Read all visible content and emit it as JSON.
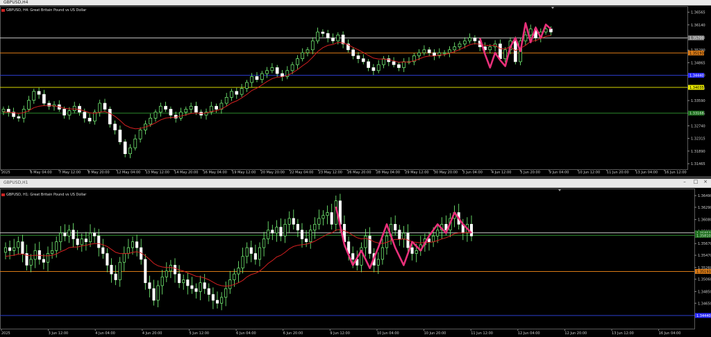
{
  "charts": [
    {
      "window_title": "GBPUSD,H4",
      "label": "GBPUSD, H4:  Great Britain Pound vs US Dollar",
      "price_axis": [
        "1.36565",
        "1.36140",
        "1.35715",
        "1.35290",
        "1.34865",
        "1.34440",
        "1.34015",
        "1.33590",
        "1.33165",
        "1.32740",
        "1.32315",
        "1.31890",
        "1.31465"
      ],
      "time_axis": [
        "2025",
        "6 May 04:00",
        "7 May 12:00",
        "8 May 20:00",
        "12 May 04:00",
        "13 May 12:00",
        "14 May 20:00",
        "16 May 04:00",
        "19 May 12:00",
        "20 May 20:00",
        "22 May 04:00",
        "23 May 12:00",
        "26 May 20:00",
        "28 May 04:00",
        "29 May 12:00",
        "30 May 20:00",
        "3 Jun 04:00",
        "4 Jun 12:00",
        "5 Jun 20:00",
        "9 Jun 04:00",
        "10 Jun 12:00",
        "11 Jun 20:00",
        "13 Jun 04:00",
        "16 Jun 12:00"
      ],
      "levels": [
        {
          "price": "1.35700",
          "color": "#c9c9c9",
          "tag_color": "#7a7a7a",
          "tag_text": "#ffffff"
        },
        {
          "price": "1.35193",
          "color": "#d97a16",
          "tag_color": "#d97a16",
          "tag_text": "#000000"
        },
        {
          "price": "1.34440",
          "color": "#2d3fd0",
          "tag_color": "#2a2aff",
          "tag_text": "#ffffff"
        },
        {
          "price": "1.34035",
          "color": "#d8d800",
          "tag_color": "#e8e800",
          "tag_text": "#000000"
        },
        {
          "price": "1.33168",
          "color": "#2d8a2d",
          "tag_color": "#1e6e1e",
          "tag_text": "#cfe8cf"
        }
      ]
    },
    {
      "window_title": "GBPUSD,H1",
      "label": "GBPUSD, H1:  Great Britain Pound vs US Dollar",
      "price_axis": [
        "1.36490",
        "1.36290",
        "1.36080",
        "1.35880",
        "1.35670",
        "1.35470",
        "1.35260",
        "1.35060",
        "1.34850",
        "1.34650",
        "1.34440"
      ],
      "time_axis": [
        "2025",
        "3 Jun 12:00",
        "4 Jun 04:00",
        "4 Jun 20:00",
        "5 Jun 12:00",
        "6 Jun 04:00",
        "6 Jun 20:00",
        "9 Jun 12:00",
        "10 Jun 04:00",
        "10 Jun 20:00",
        "11 Jun 12:00",
        "12 Jun 04:00",
        "12 Jun 20:00",
        "13 Jun 12:00",
        "16 Jun 04:00"
      ],
      "levels": [
        {
          "price": "1.35853",
          "color": "#c9c9c9",
          "tag_color": "#1e6e1e",
          "tag_text": "#cfe8cf"
        },
        {
          "price": "1.35810",
          "color": "#2d8a2d",
          "tag_color": "#1e6e1e",
          "tag_text": "#cfe8cf"
        },
        {
          "price": "1.35193",
          "color": "#d97a16",
          "tag_color": "#d97a16",
          "tag_text": "#000000"
        },
        {
          "price": "1.34440",
          "color": "#2d3fd0",
          "tag_color": "#2a2aff",
          "tag_text": "#ffffff"
        }
      ]
    }
  ],
  "chart_data": [
    {
      "type": "candlestick",
      "title": "GBPUSD, H4: Great Britain Pound vs US Dollar",
      "ylim": [
        1.3135,
        1.3665
      ],
      "series": [
        {
          "name": "close",
          "values": [
            1.333,
            1.332,
            1.3305,
            1.33,
            1.333,
            1.336,
            1.339,
            1.338,
            1.335,
            1.334,
            1.3345,
            1.333,
            1.331,
            1.3325,
            1.334,
            1.332,
            1.33,
            1.329,
            1.332,
            1.335,
            1.333,
            1.328,
            1.326,
            1.322,
            1.318,
            1.32,
            1.323,
            1.326,
            1.328,
            1.33,
            1.332,
            1.334,
            1.333,
            1.331,
            1.33,
            1.332,
            1.333,
            1.334,
            1.332,
            1.331,
            1.332,
            1.334,
            1.333,
            1.335,
            1.337,
            1.339,
            1.338,
            1.34,
            1.342,
            1.344,
            1.343,
            1.345,
            1.346,
            1.347,
            1.345,
            1.344,
            1.346,
            1.348,
            1.35,
            1.352,
            1.353,
            1.356,
            1.359,
            1.3585,
            1.357,
            1.356,
            1.358,
            1.355,
            1.353,
            1.351,
            1.35,
            1.349,
            1.347,
            1.346,
            1.348,
            1.35,
            1.349,
            1.348,
            1.347,
            1.349,
            1.349,
            1.351,
            1.352,
            1.353,
            1.352,
            1.351,
            1.352,
            1.352,
            1.353,
            1.354,
            1.355,
            1.356,
            1.357,
            1.356,
            1.354,
            1.353,
            1.354,
            1.355,
            1.35,
            1.353,
            1.356,
            1.349,
            1.356,
            1.358,
            1.36,
            1.357,
            1.359,
            1.36,
            1.359
          ]
        },
        {
          "name": "moving-average",
          "values": [
            1.332,
            1.332,
            1.3318,
            1.3316,
            1.3318,
            1.3325,
            1.3335,
            1.334,
            1.3342,
            1.3342,
            1.3341,
            1.3338,
            1.3333,
            1.3331,
            1.3331,
            1.3329,
            1.3324,
            1.3318,
            1.3316,
            1.332,
            1.3322,
            1.3316,
            1.3306,
            1.3292,
            1.3276,
            1.3268,
            1.3264,
            1.3265,
            1.327,
            1.3276,
            1.3284,
            1.3294,
            1.33,
            1.3302,
            1.3303,
            1.3307,
            1.3311,
            1.3316,
            1.3317,
            1.3316,
            1.3317,
            1.3322,
            1.3325,
            1.3331,
            1.334,
            1.3351,
            1.3358,
            1.3368,
            1.338,
            1.3393,
            1.3401,
            1.3412,
            1.3423,
            1.3433,
            1.3438,
            1.3439,
            1.3444,
            1.3452,
            1.3463,
            1.3476,
            1.3488,
            1.3505,
            1.3524,
            1.3537,
            1.3545,
            1.3548,
            1.3555,
            1.3553,
            1.3547,
            1.3538,
            1.353,
            1.3521,
            1.3511,
            1.3502,
            1.3499,
            1.3499,
            1.3497,
            1.3493,
            1.3488,
            1.3489,
            1.3489,
            1.3493,
            1.3499,
            1.3506,
            1.3509,
            1.3509,
            1.3512,
            1.3514,
            1.3518,
            1.3524,
            1.3531,
            1.3539,
            1.3547,
            1.3551,
            1.3549,
            1.3545,
            1.3544,
            1.3545,
            1.3534,
            1.3533,
            1.354,
            1.3527,
            1.3535,
            1.3545,
            1.3558,
            1.3561,
            1.3568,
            1.3575,
            1.3578
          ]
        },
        {
          "name": "zigzag",
          "x": [
            94,
            95,
            96,
            97,
            98,
            99,
            100,
            101,
            102,
            103,
            104,
            105,
            106,
            107,
            108
          ],
          "values": [
            1.357,
            1.3515,
            1.347,
            1.352,
            1.3495,
            1.3475,
            1.354,
            1.357,
            1.3525,
            1.362,
            1.3555,
            1.3605,
            1.357,
            1.3615,
            1.36
          ]
        }
      ]
    },
    {
      "type": "candlestick",
      "title": "GBPUSD, H1: Great Britain Pound vs US Dollar",
      "ylim": [
        1.3425,
        1.3655
      ],
      "series": [
        {
          "name": "close",
          "values": [
            1.356,
            1.3555,
            1.356,
            1.357,
            1.355,
            1.353,
            1.354,
            1.3555,
            1.354,
            1.3535,
            1.355,
            1.3555,
            1.357,
            1.3585,
            1.358,
            1.359,
            1.3575,
            1.3565,
            1.3575,
            1.357,
            1.3585,
            1.358,
            1.356,
            1.355,
            1.353,
            1.3515,
            1.3505,
            1.3535,
            1.355,
            1.356,
            1.357,
            1.356,
            1.354,
            1.35,
            1.349,
            1.347,
            1.3495,
            1.351,
            1.352,
            1.353,
            1.3515,
            1.35,
            1.3505,
            1.3495,
            1.349,
            1.3485,
            1.35,
            1.349,
            1.348,
            1.347,
            1.3465,
            1.3475,
            1.349,
            1.3505,
            1.3515,
            1.3525,
            1.3545,
            1.356,
            1.355,
            1.354,
            1.356,
            1.3575,
            1.359,
            1.3585,
            1.3595,
            1.358,
            1.36,
            1.361,
            1.36,
            1.359,
            1.3575,
            1.357,
            1.359,
            1.36,
            1.361,
            1.3615,
            1.362,
            1.36,
            1.364,
            1.36,
            1.357,
            1.355,
            1.354,
            1.353,
            1.356,
            1.358,
            1.355,
            1.353,
            1.354,
            1.356,
            1.358,
            1.36,
            1.359,
            1.3575,
            1.3585,
            1.356,
            1.355,
            1.3555,
            1.3565,
            1.3575,
            1.357,
            1.358,
            1.359,
            1.36,
            1.359,
            1.361,
            1.362,
            1.36,
            1.3585,
            1.36,
            1.358
          ]
        },
        {
          "name": "moving-average",
          "values": [
            1.3545,
            1.3546,
            1.3547,
            1.3549,
            1.3549,
            1.3547,
            1.3546,
            1.3547,
            1.3547,
            1.3546,
            1.3546,
            1.3547,
            1.3549,
            1.3553,
            1.3556,
            1.356,
            1.3561,
            1.3561,
            1.3563,
            1.3564,
            1.3566,
            1.3567,
            1.3567,
            1.3565,
            1.3562,
            1.3557,
            1.3552,
            1.355,
            1.355,
            1.355,
            1.3552,
            1.3553,
            1.3551,
            1.3546,
            1.354,
            1.3533,
            1.3529,
            1.3527,
            1.3526,
            1.3526,
            1.3525,
            1.3522,
            1.352,
            1.3517,
            1.3514,
            1.3511,
            1.351,
            1.3508,
            1.3505,
            1.3501,
            1.3497,
            1.3495,
            1.3494,
            1.3495,
            1.3497,
            1.35,
            1.3504,
            1.351,
            1.3514,
            1.3516,
            1.352,
            1.3526,
            1.3533,
            1.3538,
            1.3544,
            1.3547,
            1.3552,
            1.3558,
            1.3562,
            1.3564,
            1.3565,
            1.3566,
            1.3568,
            1.3571,
            1.3575,
            1.3579,
            1.3583,
            1.3585,
            1.359,
            1.3591,
            1.3589,
            1.3586,
            1.3581,
            1.3577,
            1.3575,
            1.3576,
            1.3574,
            1.357,
            1.3568,
            1.3567,
            1.3569,
            1.3572,
            1.3574,
            1.3574,
            1.3575,
            1.3573,
            1.357,
            1.3569,
            1.3568,
            1.3569,
            1.3569,
            1.357,
            1.3572,
            1.3575,
            1.3577,
            1.358,
            1.3584,
            1.3585,
            1.3585,
            1.3586,
            1.3585
          ]
        },
        {
          "name": "zigzag",
          "x": [
            78,
            80,
            82,
            84,
            86,
            88,
            90,
            92,
            94,
            96,
            98,
            100,
            102,
            104,
            106,
            108,
            110
          ],
          "values": [
            1.363,
            1.3565,
            1.353,
            1.3555,
            1.3525,
            1.356,
            1.36,
            1.356,
            1.353,
            1.357,
            1.3555,
            1.358,
            1.36,
            1.3585,
            1.362,
            1.36,
            1.3585
          ]
        }
      ]
    }
  ]
}
